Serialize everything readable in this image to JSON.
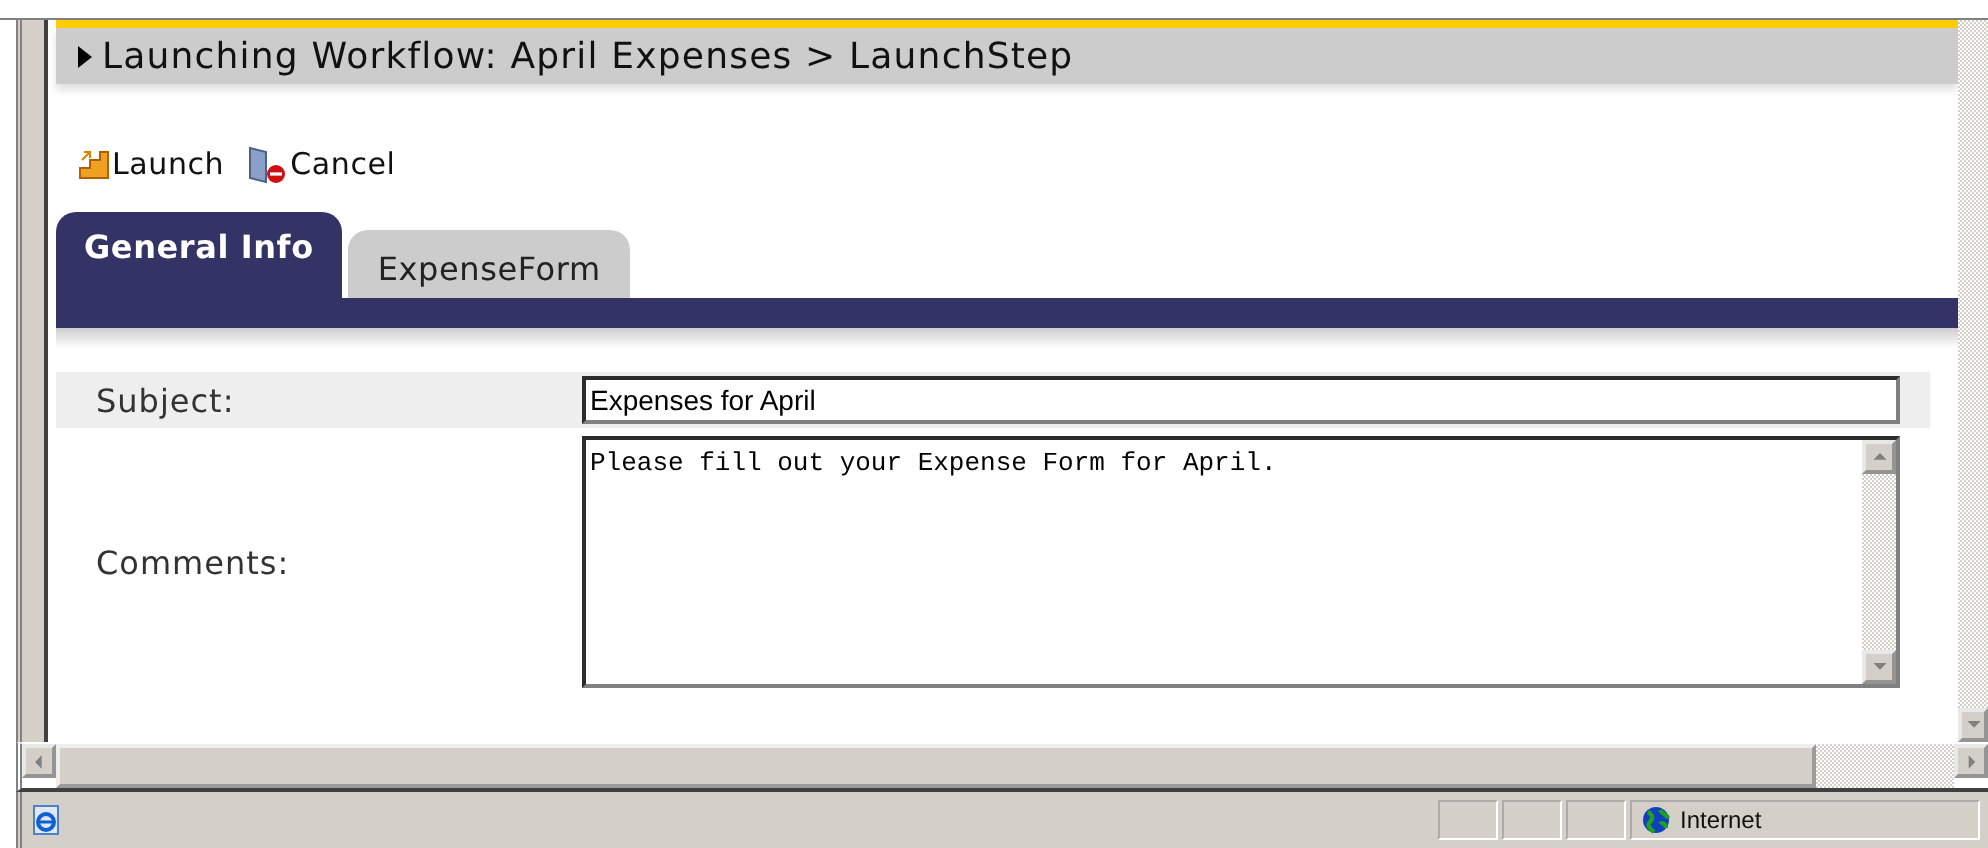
{
  "header": {
    "title": "Launching Workflow: April Expenses > LaunchStep"
  },
  "toolbar": [
    {
      "kind": "launch",
      "label": "Launch"
    },
    {
      "kind": "cancel",
      "label": "Cancel"
    }
  ],
  "tabs": [
    {
      "label": "General Info",
      "selected": true
    },
    {
      "label": "ExpenseForm",
      "selected": false
    }
  ],
  "form": {
    "fields": [
      {
        "kind": "text",
        "label": "Subject:",
        "value": "Expenses for April"
      },
      {
        "kind": "textarea",
        "label": "Comments:",
        "value": "Please fill out your Expense Form for April."
      }
    ]
  },
  "status_bar": {
    "zone": "Internet"
  }
}
